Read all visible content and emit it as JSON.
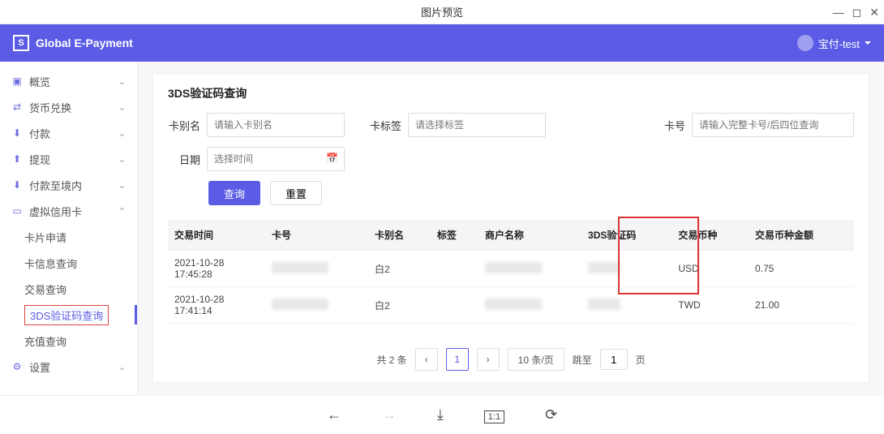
{
  "window": {
    "title": "图片预览"
  },
  "brand": {
    "name": "Global E-Payment"
  },
  "user": {
    "name": "宝付-test"
  },
  "sidebar": {
    "items": [
      {
        "label": "概览"
      },
      {
        "label": "货币兑换"
      },
      {
        "label": "付款"
      },
      {
        "label": "提现"
      },
      {
        "label": "付款至境内"
      },
      {
        "label": "虚拟信用卡"
      },
      {
        "label": "设置"
      }
    ],
    "sub": [
      {
        "label": "卡片申请"
      },
      {
        "label": "卡信息查询"
      },
      {
        "label": "交易查询"
      },
      {
        "label": "3DS验证码查询"
      },
      {
        "label": "充值查询"
      }
    ]
  },
  "page": {
    "title": "3DS验证码查询"
  },
  "form": {
    "alias_label": "卡别名",
    "alias_placeholder": "请输入卡别名",
    "tag_label": "卡标签",
    "tag_placeholder": "请选择标签",
    "cardno_label": "卡号",
    "cardno_placeholder": "请输入完整卡号/后四位查询",
    "date_label": "日期",
    "date_placeholder": "选择时间",
    "search_btn": "查询",
    "reset_btn": "重置"
  },
  "table": {
    "headers": {
      "time": "交易时间",
      "cardno": "卡号",
      "alias": "卡别名",
      "tag": "标签",
      "merchant": "商户名称",
      "code3ds": "3DS验证码",
      "currency": "交易币种",
      "amount": "交易币种金额"
    },
    "rows": [
      {
        "time": "2021-10-28 17:45:28",
        "alias": "白2",
        "currency": "USD",
        "amount": "0.75"
      },
      {
        "time": "2021-10-28 17:41:14",
        "alias": "白2",
        "currency": "TWD",
        "amount": "21.00"
      }
    ]
  },
  "pager": {
    "total_label": "共 2 条",
    "page": "1",
    "per_page_label": "10 条/页",
    "jump_label": "跳至",
    "jump_value": "1",
    "jump_suffix": "页"
  }
}
